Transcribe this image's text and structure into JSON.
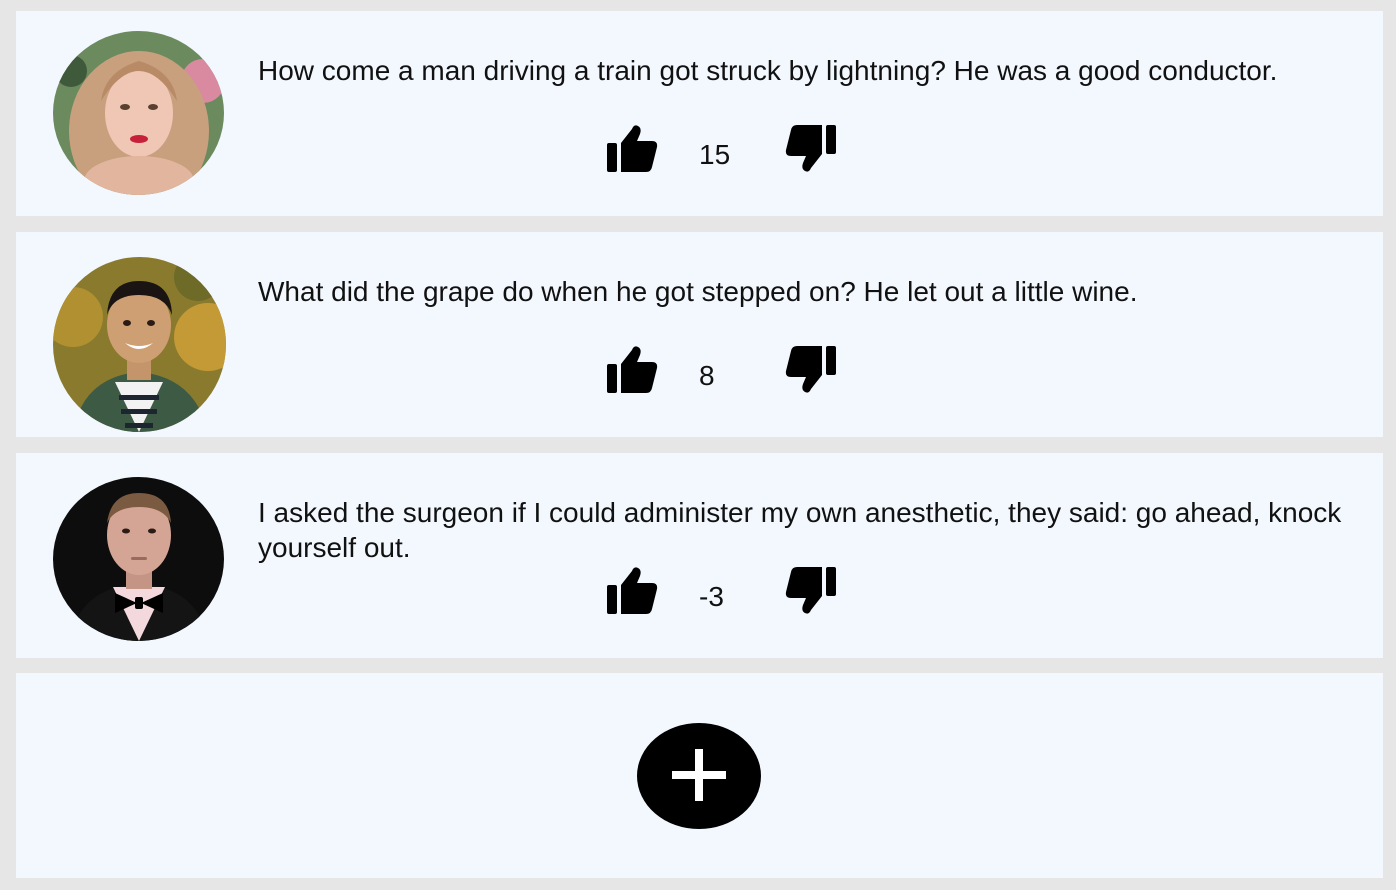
{
  "jokes": [
    {
      "text": "How come a man driving a train got struck by lightning? He was a good conductor.",
      "score": "15",
      "avatar": "woman-portrait-avatar"
    },
    {
      "text": "What did the grape do when he got stepped on? He let out a little wine.",
      "score": "8",
      "avatar": "man-smiling-portrait-avatar"
    },
    {
      "text": "I asked the surgeon if I could administer my own anesthetic, they said: go ahead, knock yourself out.",
      "score": "-3",
      "avatar": "man-bowtie-portrait-avatar"
    }
  ],
  "icons": {
    "upvote": "thumbs-up-icon",
    "downvote": "thumbs-down-icon",
    "add": "plus-icon"
  },
  "colors": {
    "background": "#e6e6e6",
    "card": "#f3f8fe",
    "icon": "#000000"
  }
}
